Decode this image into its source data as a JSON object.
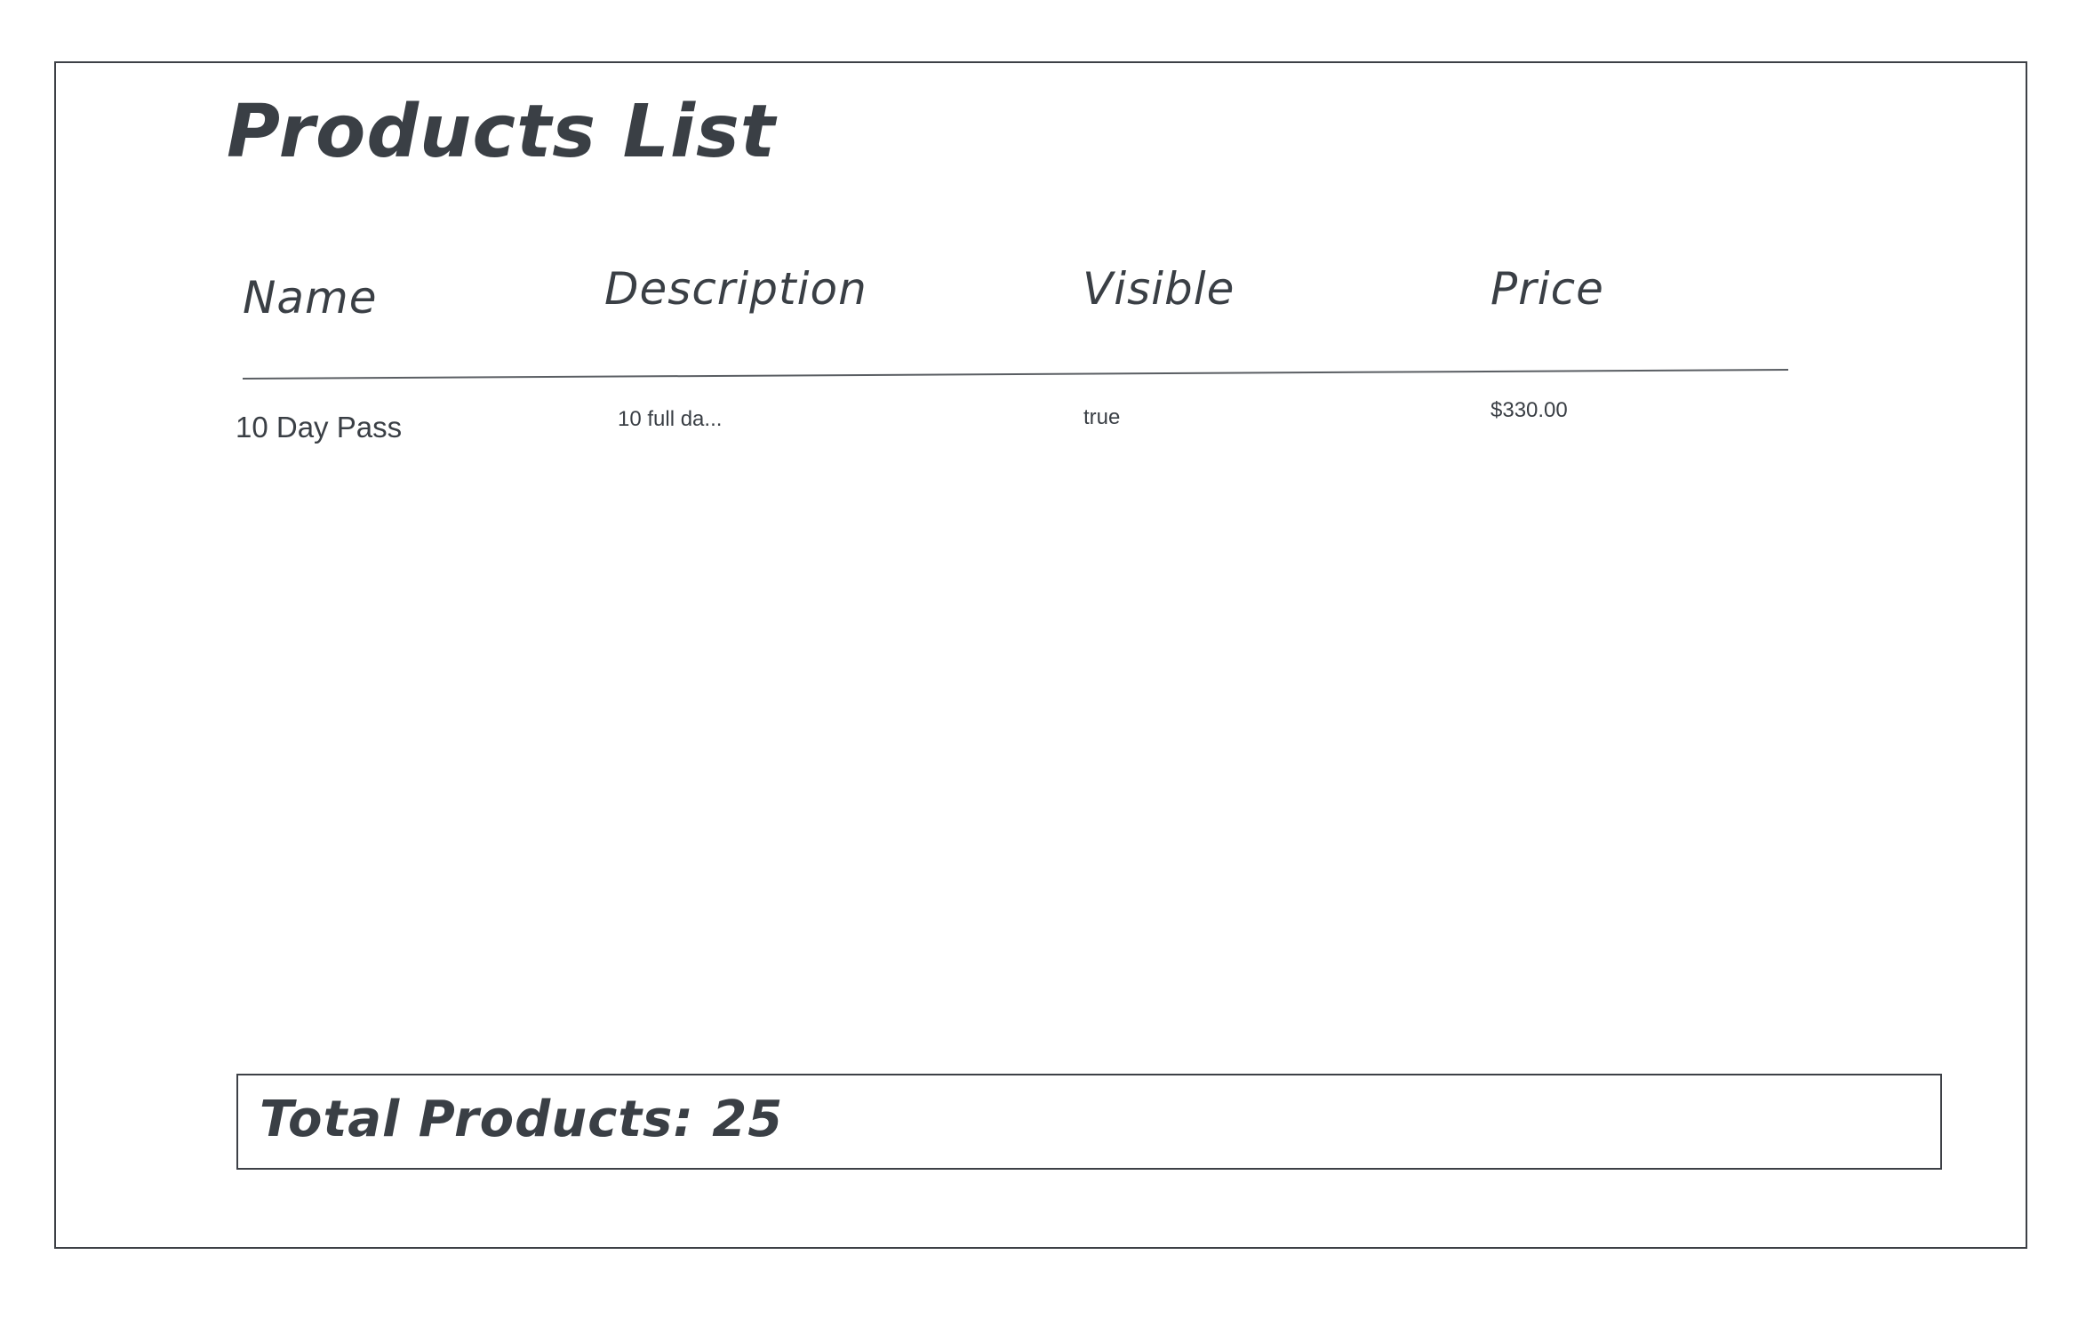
{
  "page": {
    "title": "Products List"
  },
  "table": {
    "columns": [
      "Name",
      "Description",
      "Visible",
      "Price"
    ],
    "rows": [
      {
        "name": "10 Day Pass",
        "description": "10 full da...",
        "visible": "true",
        "price": "$330.00"
      }
    ]
  },
  "footer": {
    "total_label": "Total Products: 25"
  },
  "colors": {
    "ink": "#3a3f45",
    "border": "#3d4046",
    "background": "#ffffff"
  }
}
